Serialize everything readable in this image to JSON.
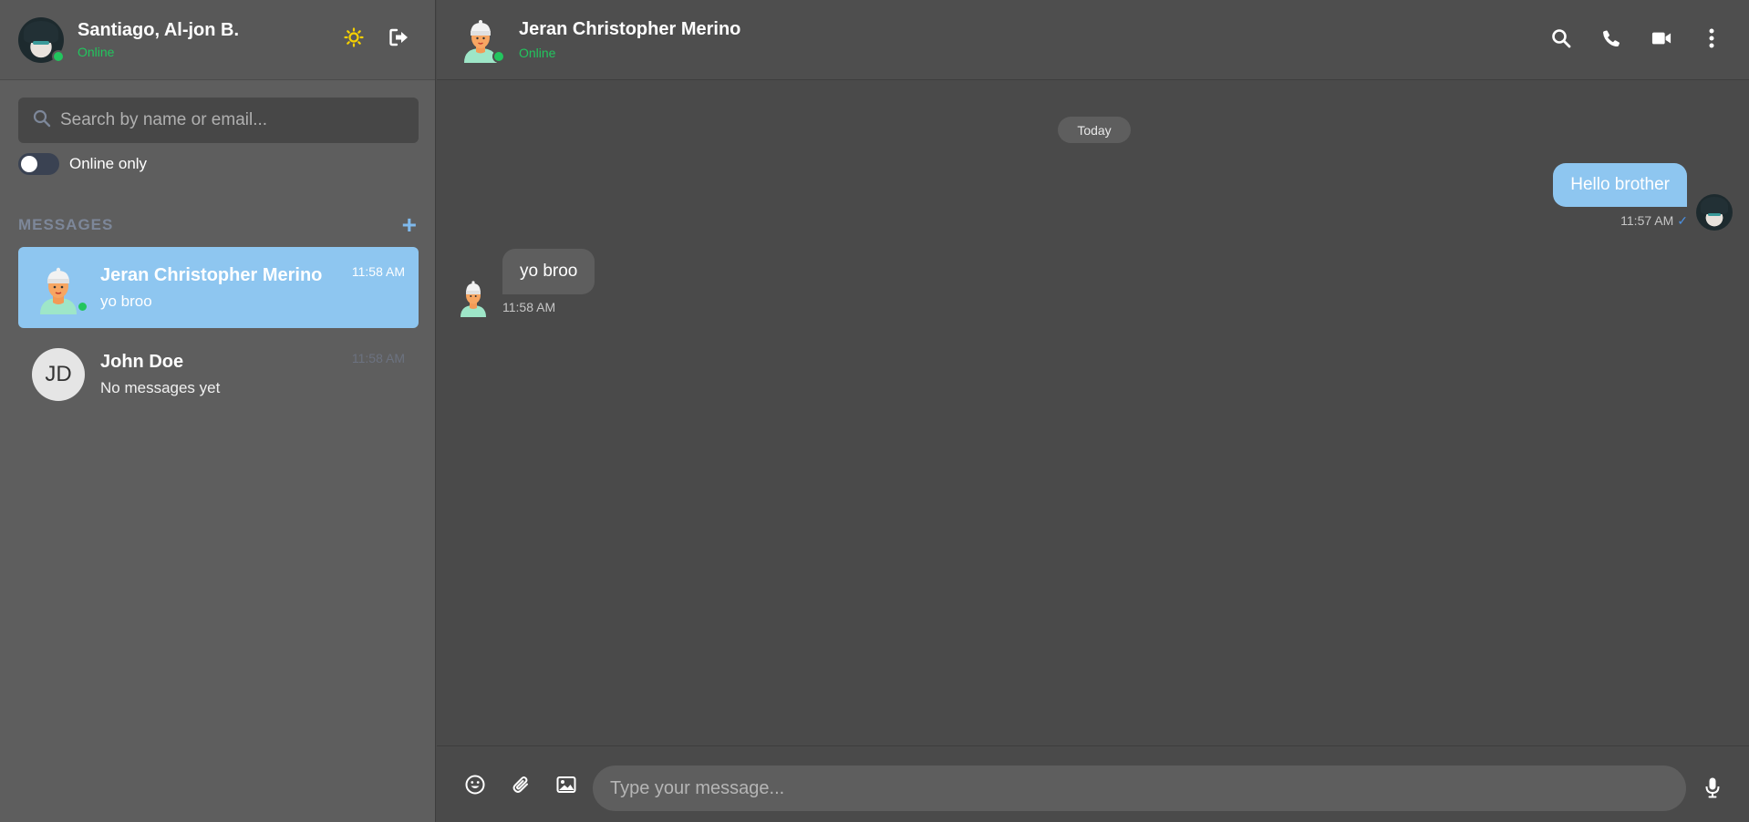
{
  "sidebar": {
    "user": {
      "name": "Santiago, Al-jon B.",
      "status": "Online"
    },
    "search": {
      "placeholder": "Search by name or email..."
    },
    "toggle": {
      "label": "Online only"
    },
    "section_title": "MESSAGES",
    "chats": [
      {
        "name": "Jeran Christopher Merino",
        "preview": "yo broo",
        "time": "11:58 AM",
        "initials": ""
      },
      {
        "name": "John Doe",
        "preview": "No messages yet",
        "time": "11:58 AM",
        "initials": "JD"
      }
    ]
  },
  "conversation": {
    "contact": {
      "name": "Jeran Christopher Merino",
      "status": "Online"
    },
    "date_divider": "Today",
    "messages": [
      {
        "direction": "out",
        "text": "Hello brother",
        "time": "11:57 AM",
        "check": "✓"
      },
      {
        "direction": "in",
        "text": "yo broo",
        "time": "11:58 AM"
      }
    ],
    "composer": {
      "placeholder": "Type your message..."
    }
  },
  "colors": {
    "accent": "#8ec6f0",
    "online": "#22c55e",
    "theme_icon": "#f5d000"
  },
  "icons": [
    "sun-icon",
    "logout-icon",
    "search-icon",
    "phone-icon",
    "video-icon",
    "more-icon",
    "emoji-icon",
    "paperclip-icon",
    "image-icon",
    "microphone-icon",
    "plus-icon"
  ]
}
